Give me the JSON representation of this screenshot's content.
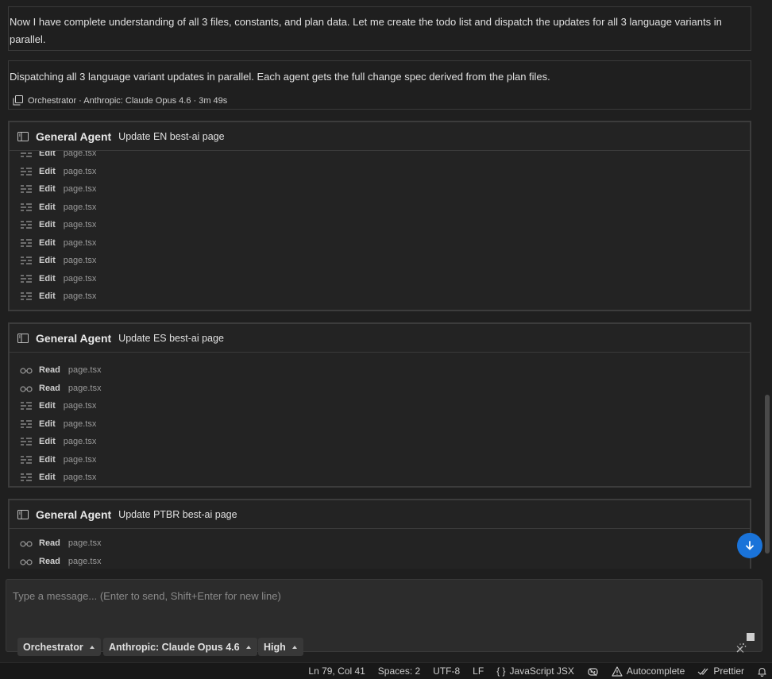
{
  "messages": {
    "first": "Now I have complete understanding of all 3 files, constants, and plan data. Let me create the todo list and dispatch the updates for all 3 language variants in parallel.",
    "second": "Dispatching all 3 language variant updates in parallel. Each agent gets the full change spec derived from the plan files.",
    "meta": "Orchestrator · Anthropic: Claude Opus 4.6 · 3m 49s"
  },
  "agents": [
    {
      "name": "General Agent",
      "task": "Update EN best-ai page",
      "rows": [
        {
          "op": "Edit",
          "file": "page.tsx"
        },
        {
          "op": "Edit",
          "file": "page.tsx"
        },
        {
          "op": "Edit",
          "file": "page.tsx"
        },
        {
          "op": "Edit",
          "file": "page.tsx"
        },
        {
          "op": "Edit",
          "file": "page.tsx"
        },
        {
          "op": "Edit",
          "file": "page.tsx"
        },
        {
          "op": "Edit",
          "file": "page.tsx"
        },
        {
          "op": "Edit",
          "file": "page.tsx"
        },
        {
          "op": "Edit",
          "file": "page.tsx"
        }
      ]
    },
    {
      "name": "General Agent",
      "task": "Update ES best-ai page",
      "rows": [
        {
          "op": "Read",
          "file": "page.tsx"
        },
        {
          "op": "Read",
          "file": "page.tsx"
        },
        {
          "op": "Edit",
          "file": "page.tsx"
        },
        {
          "op": "Edit",
          "file": "page.tsx"
        },
        {
          "op": "Edit",
          "file": "page.tsx"
        },
        {
          "op": "Edit",
          "file": "page.tsx"
        },
        {
          "op": "Edit",
          "file": "page.tsx"
        }
      ]
    },
    {
      "name": "General Agent",
      "task": "Update PTBR best-ai page",
      "rows": [
        {
          "op": "Read",
          "file": "page.tsx"
        },
        {
          "op": "Read",
          "file": "page.tsx"
        }
      ]
    }
  ],
  "icons": {
    "agent": "sidebar-panel-icon",
    "read": "glasses-icon",
    "edit": "list-edit-icon",
    "copy": "copy-icon",
    "scroll": "arrow-down-icon",
    "wand": "magic-wand-icon",
    "stop": "stop-icon"
  },
  "composer": {
    "placeholder": "Type a message... (Enter to send, Shift+Enter for new line)",
    "mode": "Orchestrator",
    "model": "Anthropic: Claude Opus 4.6",
    "level": "High"
  },
  "statusbar": {
    "position": "Ln 79, Col 41",
    "spaces": "Spaces: 2",
    "encoding": "UTF-8",
    "eol": "LF",
    "language_glyph": "{ }",
    "language": "JavaScript JSX",
    "autocomplete": "Autocomplete",
    "prettier": "Prettier"
  },
  "colors": {
    "background": "#1f1f1f",
    "accent": "#1a73d9",
    "statusbar": "#181818"
  }
}
